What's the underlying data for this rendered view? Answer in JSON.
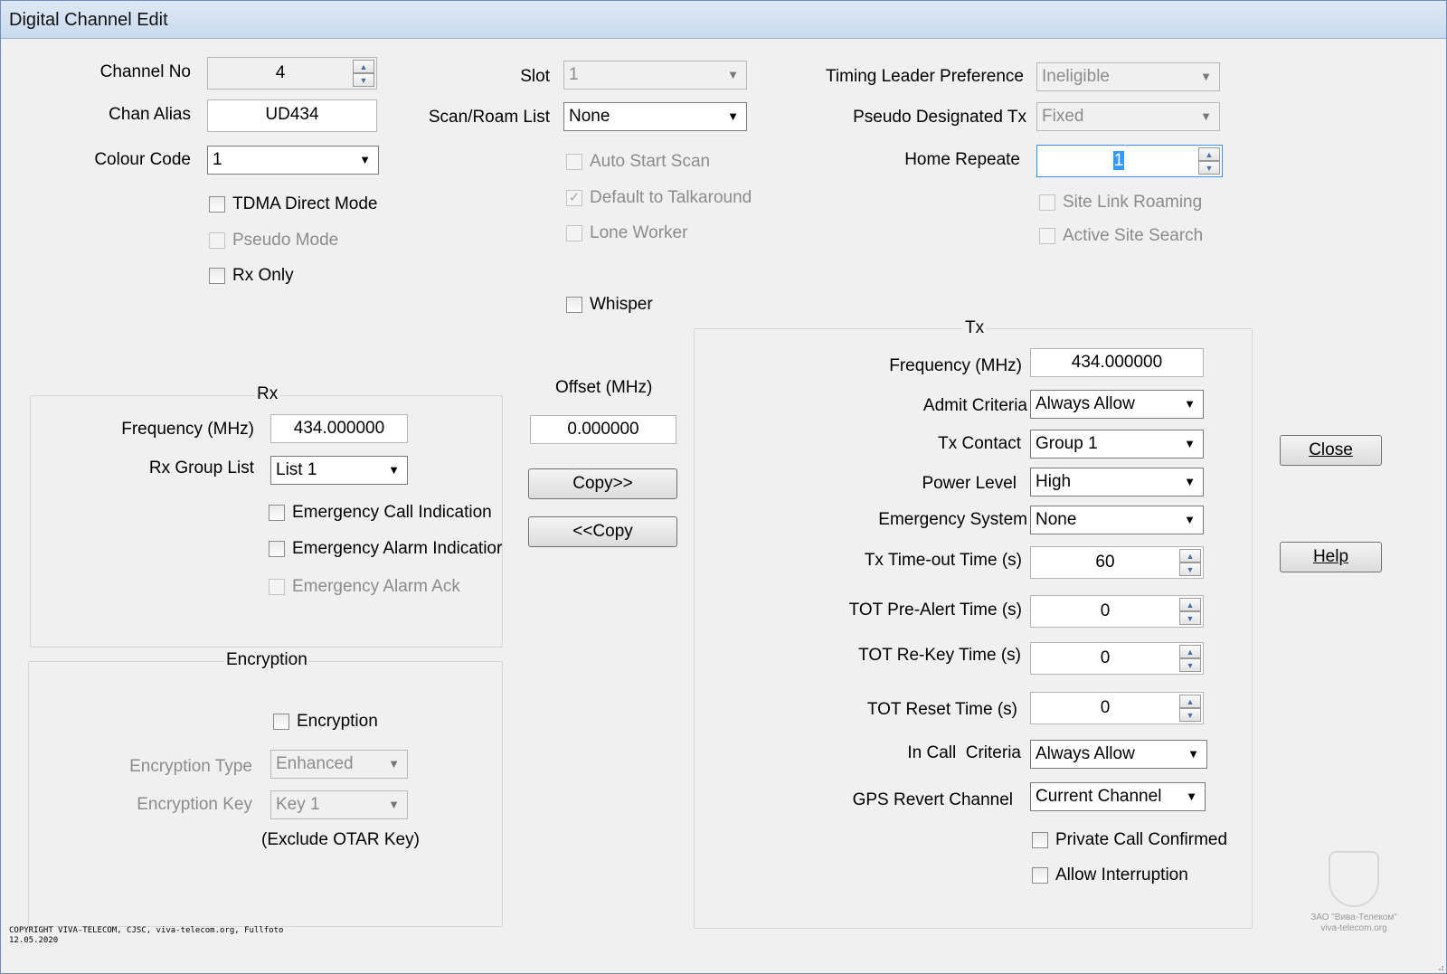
{
  "window": {
    "title": "Digital Channel Edit"
  },
  "general": {
    "channel_no_label": "Channel No",
    "channel_no_value": "4",
    "chan_alias_label": "Chan Alias",
    "chan_alias_value": "UD434",
    "colour_code_label": "Colour Code",
    "colour_code_value": "1",
    "tdma_direct_mode": "TDMA Direct Mode",
    "pseudo_mode": "Pseudo Mode",
    "rx_only": "Rx Only"
  },
  "middle": {
    "slot_label": "Slot",
    "slot_value": "1",
    "scan_roam_label": "Scan/Roam List",
    "scan_roam_value": "None",
    "auto_start_scan": "Auto Start Scan",
    "default_to_talkaround": "Default to Talkaround",
    "lone_worker": "Lone Worker",
    "whisper": "Whisper",
    "offset_label": "Offset (MHz)",
    "offset_value": "0.000000",
    "copy_right_button": "Copy>>",
    "copy_left_button": "<<Copy"
  },
  "right_top": {
    "timing_leader_label": "Timing Leader Preference",
    "timing_leader_value": "Ineligible",
    "pseudo_designated_label": "Pseudo Designated Tx",
    "pseudo_designated_value": "Fixed",
    "home_repeater_label": "Home Repeate",
    "home_repeater_value": "1",
    "site_link_roaming": "Site Link Roaming",
    "active_site_search": "Active Site Search"
  },
  "rx": {
    "group_title": "Rx",
    "frequency_label": "Frequency (MHz)",
    "frequency_value": "434.000000",
    "group_list_label": "Rx Group List",
    "group_list_value": "List 1",
    "emergency_call_indication": "Emergency Call Indication",
    "emergency_alarm_indication": "Emergency Alarm Indicatior",
    "emergency_alarm_ack": "Emergency Alarm Ack"
  },
  "encryption": {
    "group_title": "Encryption",
    "encryption_checkbox": "Encryption",
    "type_label": "Encryption Type",
    "type_value": "Enhanced",
    "key_label": "Encryption Key",
    "key_value": "Key 1",
    "exclude_note": "(Exclude OTAR Key)"
  },
  "tx": {
    "group_title": "Tx",
    "frequency_label": "Frequency (MHz)",
    "frequency_value": "434.000000",
    "admit_criteria_label": "Admit Criteria",
    "admit_criteria_value": "Always Allow",
    "tx_contact_label": "Tx Contact",
    "tx_contact_value": "Group 1",
    "power_level_label": "Power Level",
    "power_level_value": "High",
    "emergency_system_label": "Emergency System",
    "emergency_system_value": "None",
    "tx_timeout_label": "Tx Time-out Time (s)",
    "tx_timeout_value": "60",
    "tot_prealert_label": "TOT Pre-Alert Time (s)",
    "tot_prealert_value": "0",
    "tot_rekey_label": "TOT Re-Key Time (s)",
    "tot_rekey_value": "0",
    "tot_reset_label": "TOT Reset Time (s)",
    "tot_reset_value": "0",
    "in_call_criteria_label": "In Call  Criteria",
    "in_call_criteria_value": "Always Allow",
    "gps_revert_label": "GPS Revert Channel",
    "gps_revert_value": "Current Channel",
    "private_call_confirmed": "Private Call Confirmed",
    "allow_interruption": "Allow Interruption"
  },
  "buttons": {
    "close_label": "Close",
    "help_label": "Help"
  },
  "footer": {
    "copyright_line1": "COPYRIGHT VIVA-TELECOM, CJSC, viva-telecom.org, Fullfoto",
    "copyright_line2": "12.05.2020",
    "watermark_line1": "ЗАО \"Вива-Телеком\"",
    "watermark_line2": "viva-telecom.org"
  }
}
